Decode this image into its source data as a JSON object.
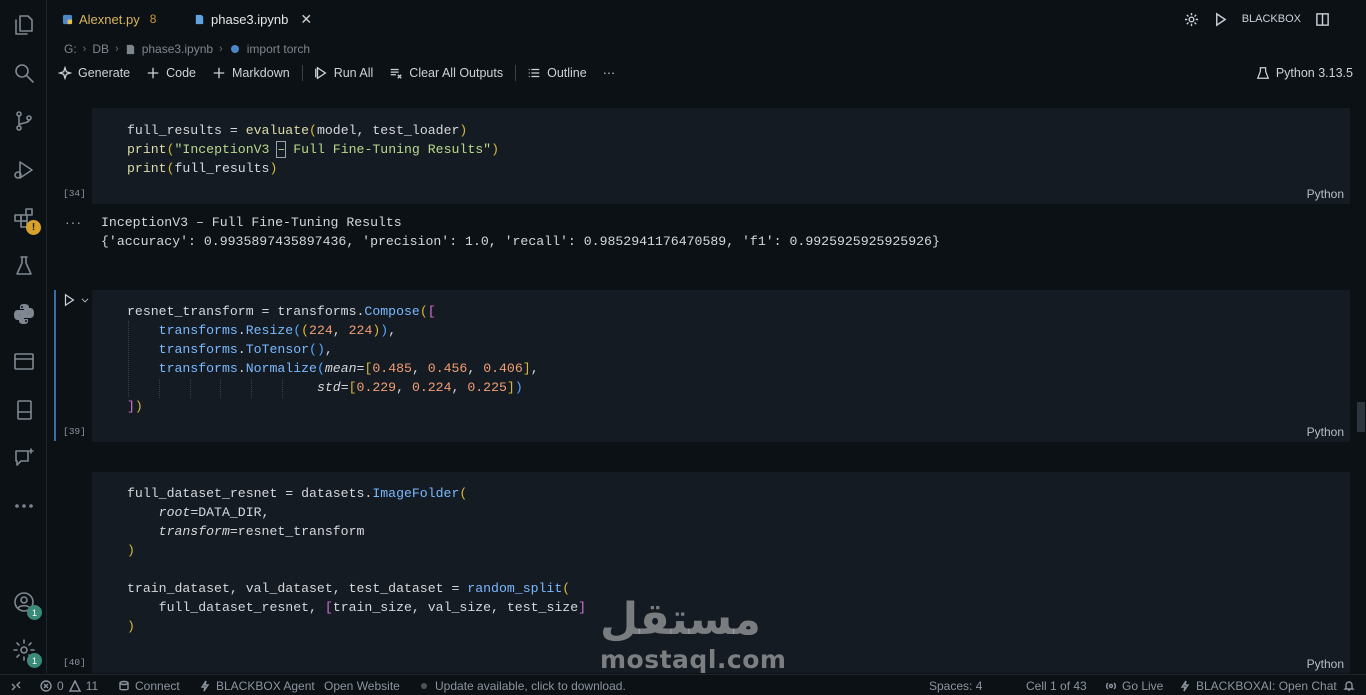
{
  "tabs": [
    {
      "label": "Alexnet.py",
      "problems": "8",
      "active": false
    },
    {
      "label": "phase3.ipynb",
      "active": true
    }
  ],
  "top_right": {
    "account_label": "BLACKBOX"
  },
  "breadcrumb": [
    "G:",
    "DB",
    "phase3.ipynb",
    "import torch"
  ],
  "toolbar": {
    "generate": "Generate",
    "code": "Code",
    "markdown": "Markdown",
    "run_all": "Run All",
    "clear_outputs": "Clear All Outputs",
    "outline": "Outline",
    "more": "···",
    "kernel": "Python 3.13.5"
  },
  "cells": [
    {
      "exec": "[34]",
      "lang": "Python",
      "output": [
        "InceptionV3 – Full Fine-Tuning Results",
        "{'accuracy': 0.9935897435897436, 'precision': 1.0, 'recall': 0.9852941176470589, 'f1': 0.9925925925925926}"
      ]
    },
    {
      "exec": "[39]",
      "lang": "Python"
    },
    {
      "exec": "[40]",
      "lang": "Python"
    }
  ],
  "output_dots": "···",
  "status": {
    "errors": "0",
    "warnings": "11",
    "connect": "Connect",
    "agent": "BLACKBOX Agent",
    "open_website": "Open Website",
    "update": "Update available, click to download.",
    "spaces": "Spaces: 4",
    "cell": "Cell 1 of 43",
    "go_live": "Go Live",
    "open_chat": "BLACKBOXAI: Open Chat"
  },
  "badges": {
    "accounts": "1",
    "settings": "1"
  },
  "watermark": {
    "arabic": "مستقل",
    "latin": "mostaql.com"
  },
  "colors": {
    "accent": "#3b6e9e",
    "badge": "#3a8a7a",
    "warning": "#d7a12c"
  }
}
